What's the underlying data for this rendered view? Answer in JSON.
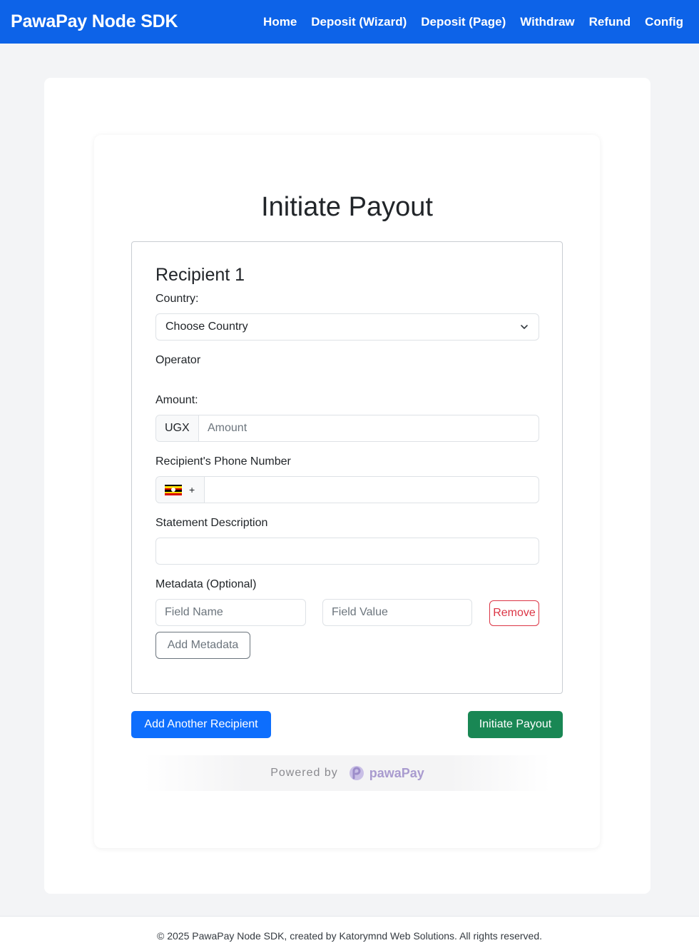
{
  "nav": {
    "brand": "PawaPay Node SDK",
    "links": [
      "Home",
      "Deposit (Wizard)",
      "Deposit (Page)",
      "Withdraw",
      "Refund",
      "Config"
    ]
  },
  "page": {
    "title": "Initiate Payout"
  },
  "recipient": {
    "heading": "Recipient 1",
    "country_label": "Country:",
    "country_value": "Choose Country",
    "operator_label": "Operator",
    "amount_label": "Amount:",
    "currency": "UGX",
    "amount_placeholder": "Amount",
    "phone_label": "Recipient's Phone Number",
    "phone_prefix": "+",
    "statement_label": "Statement Description",
    "metadata_label": "Metadata (Optional)",
    "field_name_placeholder": "Field Name",
    "field_value_placeholder": "Field Value",
    "remove_label": "Remove",
    "add_metadata_label": "Add Metadata"
  },
  "actions": {
    "add_recipient_label": "Add Another Recipient",
    "initiate_label": "Initiate Payout"
  },
  "powered": {
    "text": "Powered by",
    "brand": "pawaPay"
  },
  "footer": {
    "text": "© 2025 PawaPay Node SDK, created by Katorymnd Web Solutions. All rights reserved."
  },
  "colors": {
    "navbar": "#0d63e8",
    "primary": "#0d6efd",
    "success": "#198754",
    "danger": "#dc3545"
  }
}
